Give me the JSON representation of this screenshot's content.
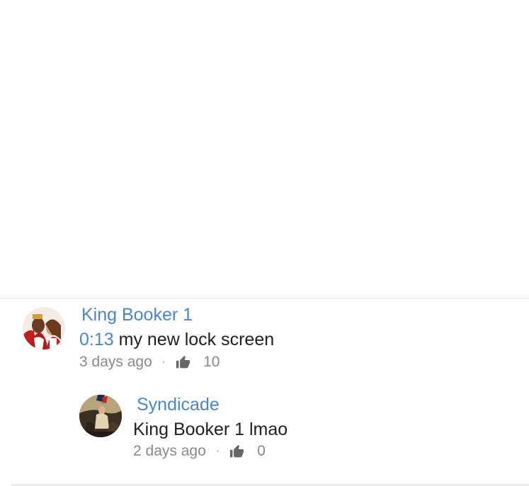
{
  "comments": [
    {
      "author": "King Booker 1",
      "timestamp_link": "0:13",
      "text": " my new lock screen",
      "age": "3 days ago",
      "separator": "·",
      "likes": "10",
      "avatar_icon": "avatar-king-booker-photo"
    },
    {
      "author": "Syndicade",
      "text": "King Booker 1 lmao",
      "age": "2 days ago",
      "separator": "·",
      "likes": "0",
      "avatar_icon": "avatar-painting-photo"
    }
  ],
  "colors": {
    "author_link": "#4a87c9",
    "body_text": "#212121",
    "meta_text": "#8a8a8a",
    "divider": "#e3e3e3"
  }
}
